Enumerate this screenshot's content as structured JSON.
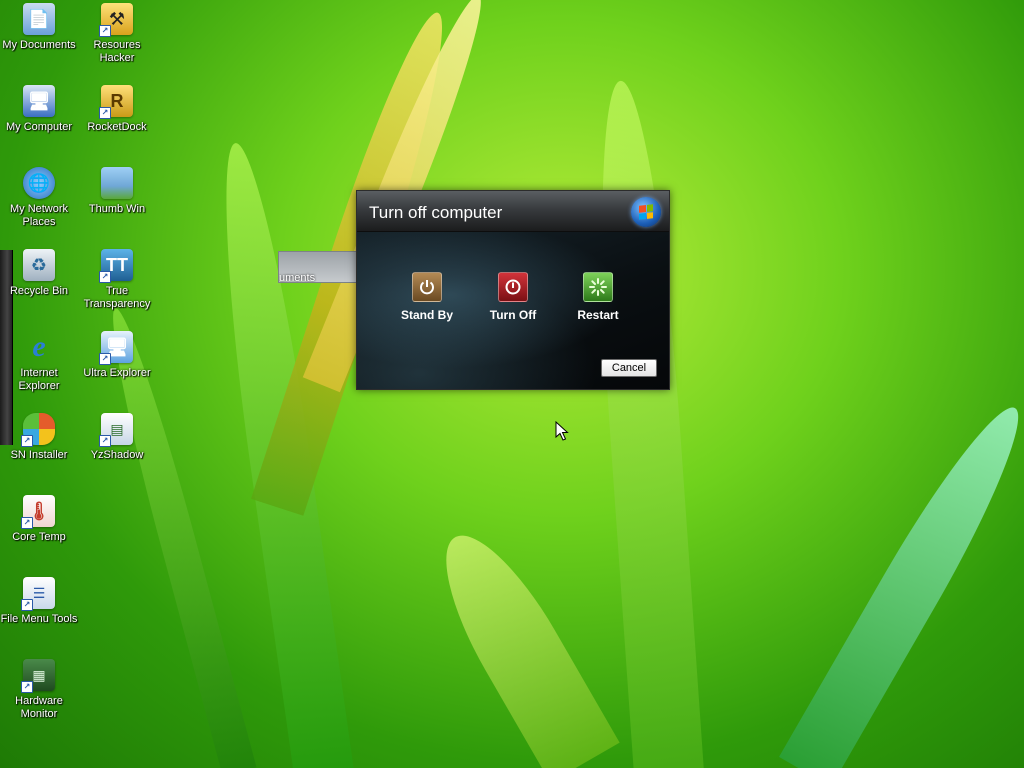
{
  "desktop": {
    "icons": [
      {
        "label": "My Documents",
        "icon": "folder-documents-icon",
        "color": "#6aa0d8"
      },
      {
        "label": "Resoures\nHacker",
        "icon": "resource-hacker-icon",
        "color": "#f2c531"
      },
      {
        "label": "My Computer",
        "icon": "computer-icon",
        "color": "#3b6fc2"
      },
      {
        "label": "RocketDock",
        "icon": "rocketdock-icon",
        "color": "#e6b52a"
      },
      {
        "label": "My Network\nPlaces",
        "icon": "network-globe-icon",
        "color": "#3c8ad6"
      },
      {
        "label": "Thumb Win",
        "icon": "thumb-win-icon",
        "color": "#6fa7d6"
      },
      {
        "label": "Recycle Bin",
        "icon": "recycle-bin-icon",
        "color": "#c9d3dd"
      },
      {
        "label": "True\nTransparency",
        "icon": "true-transparency-icon",
        "color": "#2f7fb5"
      },
      {
        "label": "Internet\nExplorer",
        "icon": "internet-explorer-icon",
        "color": "#2a7fd4"
      },
      {
        "label": "Ultra Explorer",
        "icon": "ultra-explorer-icon",
        "color": "#5da2e0"
      },
      {
        "label": "SN Installer",
        "icon": "msn-butterfly-icon",
        "color": "#e45c2b"
      },
      {
        "label": "YzShadow",
        "icon": "yzshadow-icon",
        "color": "#dfe9f3"
      },
      {
        "label": "Core Temp",
        "icon": "thermometer-icon",
        "color": "#c43c2c"
      },
      {
        "label": "File Menu Tools",
        "icon": "file-menu-tools-icon",
        "color": "#e8eef6"
      },
      {
        "label": "Hardware\nMonitor",
        "icon": "hardware-monitor-icon",
        "color": "#3a7a3a"
      }
    ]
  },
  "background_window": {
    "title": "uments"
  },
  "dialog": {
    "title": "Turn off computer",
    "stand_by": "Stand By",
    "turn_off": "Turn Off",
    "restart": "Restart",
    "cancel": "Cancel"
  }
}
